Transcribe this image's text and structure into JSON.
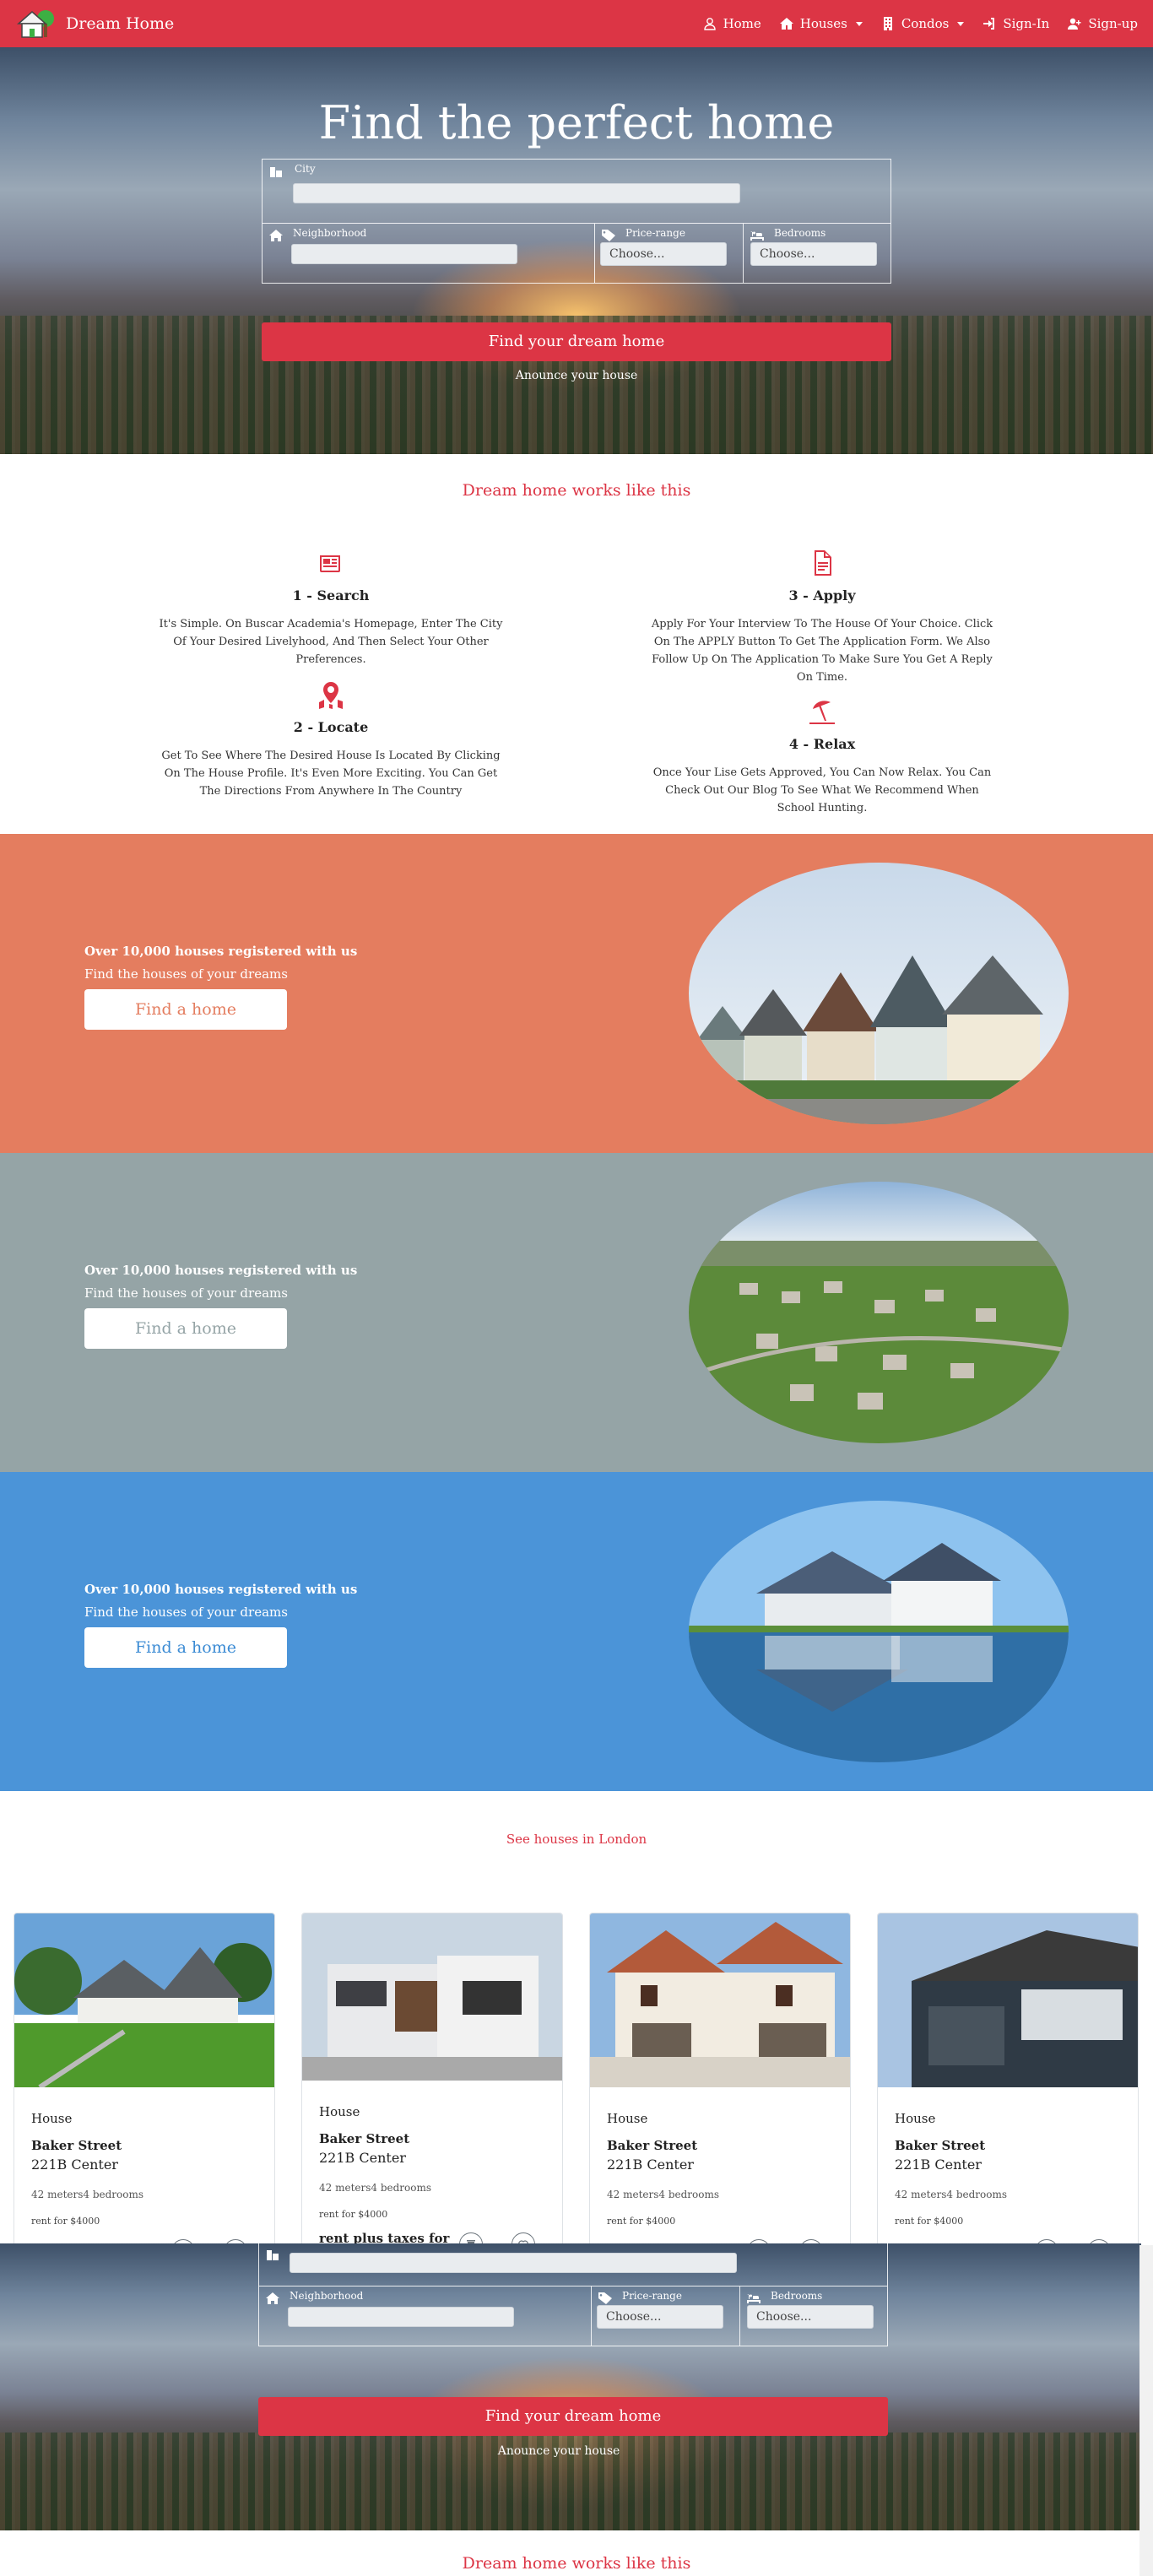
{
  "brand": {
    "name": "Dream Home"
  },
  "nav": {
    "home": "Home",
    "houses": "Houses",
    "condos": "Condos",
    "signin": "Sign-In",
    "signup": "Sign-up"
  },
  "hero": {
    "title": "Find the perfect home",
    "city_label": "City",
    "neighborhood_label": "Neighborhood",
    "price_label": "Price-range",
    "bedrooms_label": "Bedrooms",
    "price_value": "Choose...",
    "bedrooms_value": "Choose...",
    "button": "Find your dream home",
    "announce": "Anounce your house"
  },
  "how": {
    "title": "Dream home works like this",
    "steps": [
      {
        "title": "1 - Search",
        "text": "It's Simple. On Buscar Academia's Homepage, Enter The City Of Your Desired Livelyhood, And Then Select Your Other Preferences.",
        "icon": "newspaper-icon"
      },
      {
        "title": "2 - Locate",
        "text": "Get To See Where The Desired House Is Located By Clicking On The House Profile. It's Even More Exciting. You Can Get The Directions From Anywhere In The Country",
        "icon": "map-marker-icon"
      },
      {
        "title": "3 - Apply",
        "text": "Apply For Your Interview To The House Of Your Choice. Click On The APPLY Button To Get The Application Form. We Also Follow Up On The Application To Make Sure You Get A Reply On Time.",
        "icon": "document-icon"
      },
      {
        "title": "4 - Relax",
        "text": "Once Your Lise Gets Approved, You Can Now Relax. You Can Check Out Our Blog To See What We Recommend When School Hunting.",
        "icon": "umbrella-beach-icon"
      }
    ]
  },
  "bands": [
    {
      "headline": "Over 10,000 houses registered with us",
      "sub": "Find the houses of your dreams",
      "button": "Find a home",
      "bg": "#e47d5f",
      "btn_color": "#e47d5f"
    },
    {
      "headline": "Over 10,000 houses registered with us",
      "sub": "Find the houses of your dreams",
      "button": "Find a home",
      "bg": "#95a4a6",
      "btn_color": "#95a4a6"
    },
    {
      "headline": "Over 10,000 houses registered with us",
      "sub": "Find the houses of your dreams",
      "button": "Find a home",
      "bg": "#4b94d8",
      "btn_color": "#3b8bd4"
    }
  ],
  "listings": {
    "title": "See houses in London",
    "cards": [
      {
        "type": "House",
        "street": "Baker Street",
        "center": "221B Center",
        "meta": "42 meters4 bedrooms",
        "rent": "rent for $4000",
        "extra": ""
      },
      {
        "type": "House",
        "street": "Baker Street",
        "center": "221B Center",
        "meta": "42 meters4 bedrooms",
        "rent": "rent for $4000",
        "extra": "rent plus taxes for"
      },
      {
        "type": "House",
        "street": "Baker Street",
        "center": "221B Center",
        "meta": "42 meters4 bedrooms",
        "rent": "rent for $4000",
        "extra": ""
      },
      {
        "type": "House",
        "street": "Baker Street",
        "center": "221B Center",
        "meta": "42 meters4 bedrooms",
        "rent": "rent for $4000",
        "extra": ""
      }
    ]
  },
  "colors": {
    "primary": "#dc3545"
  }
}
